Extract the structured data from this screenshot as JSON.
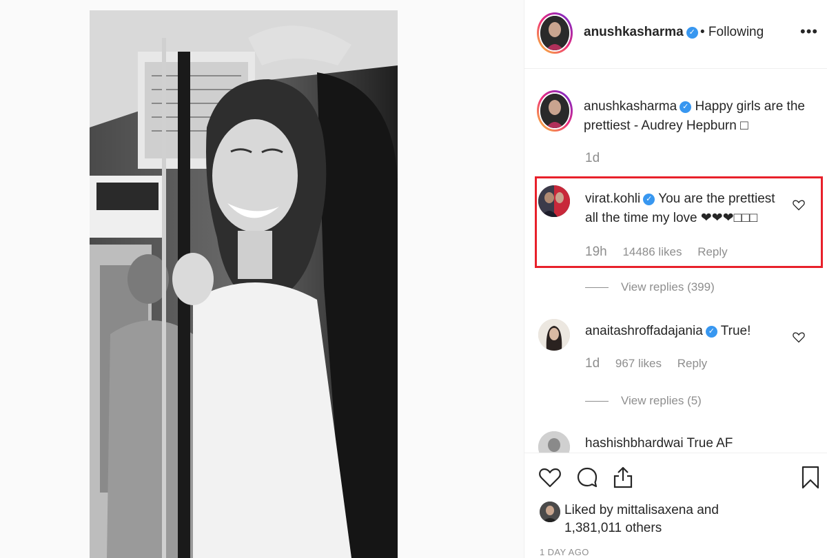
{
  "post": {
    "author": "anushkasharma",
    "follow_status": "• Following",
    "more_icon": "more-horizontal-icon"
  },
  "caption": {
    "username": "anushkasharma",
    "text": "Happy girls are the prettiest - Audrey Hepburn □",
    "time": "1d"
  },
  "comments": [
    {
      "username": "virat.kohli",
      "text": "You are the prettiest all the time my love ❤❤❤□□□",
      "time": "19h",
      "likes": "14486 likes",
      "reply_label": "Reply",
      "view_replies": "View replies (399)"
    },
    {
      "username": "anaitashroffadajania",
      "text": "True!",
      "time": "1d",
      "likes": "967 likes",
      "reply_label": "Reply",
      "view_replies": "View replies (5)"
    },
    {
      "username": "hashishbhardwai",
      "text": "True AF"
    }
  ],
  "actions": {
    "like_icon": "heart-icon",
    "comment_icon": "comment-icon",
    "share_icon": "share-icon",
    "save_icon": "bookmark-icon"
  },
  "likes_summary": {
    "prefix": "Liked by",
    "user": "mittalisaxena",
    "suffix": "and",
    "others": "1,381,011 others"
  },
  "post_date": "1 DAY AGO",
  "colors": {
    "highlight": "#e8202a",
    "verified": "#3897f0",
    "muted": "#8e8e8e"
  }
}
